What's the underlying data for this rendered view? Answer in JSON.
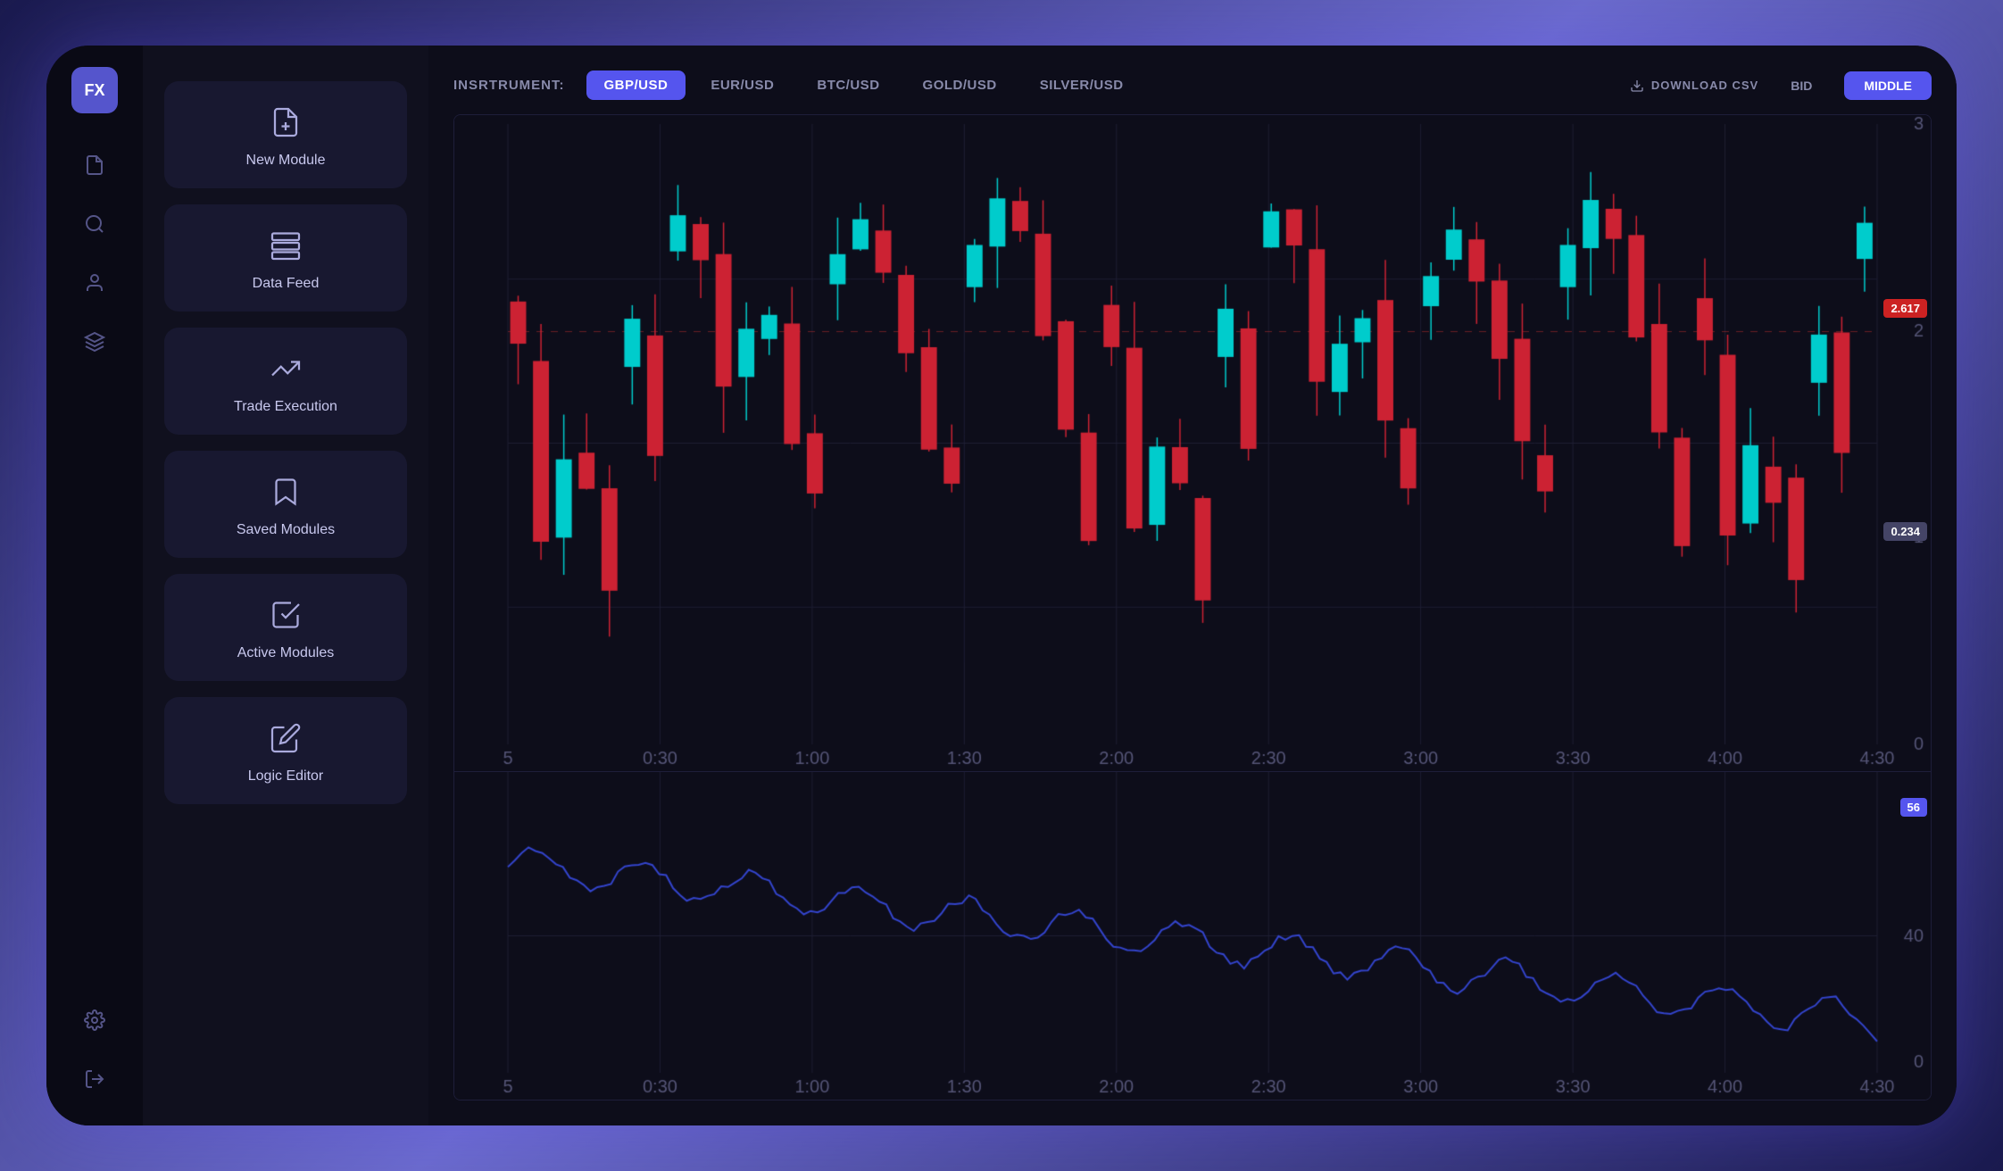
{
  "logo": {
    "text": "FX"
  },
  "iconSidebar": {
    "icons": [
      {
        "name": "file-icon",
        "glyph": "📄"
      },
      {
        "name": "person-icon",
        "glyph": "👤"
      },
      {
        "name": "layers-icon",
        "glyph": "⬡"
      },
      {
        "name": "settings-icon",
        "glyph": "⚙"
      },
      {
        "name": "logout-icon",
        "glyph": "⇥"
      }
    ]
  },
  "navSidebar": {
    "items": [
      {
        "name": "new-module",
        "label": "New Module",
        "icon": "📄"
      },
      {
        "name": "data-feed",
        "label": "Data Feed",
        "icon": "🗃"
      },
      {
        "name": "trade-execution",
        "label": "Trade Execution",
        "icon": "📈"
      },
      {
        "name": "saved-modules",
        "label": "Saved Modules",
        "icon": "🔖"
      },
      {
        "name": "active-modules",
        "label": "Active Modules",
        "icon": "📋"
      },
      {
        "name": "logic-editor",
        "label": "Logic Editor",
        "icon": "✏"
      }
    ]
  },
  "instrumentBar": {
    "label": "INSRTRUMENT:",
    "tabs": [
      {
        "id": "gbp-usd",
        "label": "GBP/USD",
        "active": true
      },
      {
        "id": "eur-usd",
        "label": "EUR/USD",
        "active": false
      },
      {
        "id": "btc-usd",
        "label": "BTC/USD",
        "active": false
      },
      {
        "id": "gold-usd",
        "label": "GOLD/USD",
        "active": false
      },
      {
        "id": "silver-usd",
        "label": "SILVER/USD",
        "active": false
      }
    ],
    "downloadCsv": "DOWNLOAD CSV",
    "bidLabel": "BID",
    "middleLabel": "MIDDLE"
  },
  "chart": {
    "priceHigh": "2.617",
    "priceLow": "0.234",
    "oscillatorValue": "56",
    "xLabels": [
      "5",
      "0:30",
      "1:00",
      "1:30",
      "2:00",
      "2:30",
      "3:00",
      "3:30",
      "4:00",
      "4:30"
    ],
    "yLabels": [
      "0",
      "1",
      "2",
      "3"
    ],
    "oscillatorLabels": [
      "0",
      "40"
    ]
  }
}
